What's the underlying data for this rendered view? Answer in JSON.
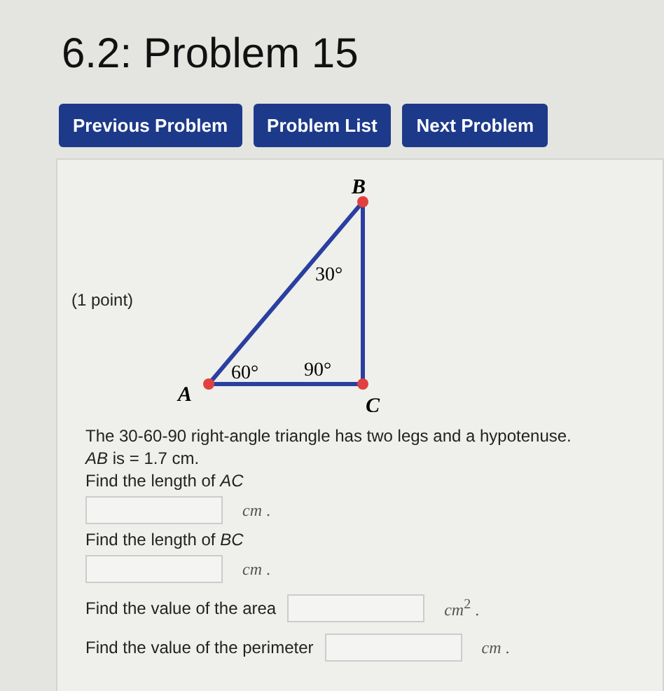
{
  "title": "6.2: Problem 15",
  "buttons": [
    "Previous Problem",
    "Problem List",
    "Next Problem"
  ],
  "points": "(1 point)",
  "figure": {
    "vertices": [
      {
        "label": "A"
      },
      {
        "label": "B"
      },
      {
        "label": "C"
      }
    ],
    "angles": [
      {
        "label": "60°"
      },
      {
        "label": "30°"
      },
      {
        "label": "90°"
      }
    ]
  },
  "statement": [
    "The 30-60-90 right-angle triangle has two legs and a hypotenuse.",
    "*AB* is = 1.7 cm."
  ],
  "questions": [
    {
      "prompt": "Find the length of *AC*",
      "unit": "*cm* .",
      "kind": "stacked"
    },
    {
      "prompt": "Find the length of *BC*",
      "unit": "*cm* .",
      "kind": "stacked"
    },
    {
      "prompt": "Find the value of the area",
      "unit": "*cm*$^{2}$ .",
      "kind": "inline"
    },
    {
      "prompt": "Find the value of the perimeter",
      "unit": "*cm* .",
      "kind": "inline"
    }
  ]
}
